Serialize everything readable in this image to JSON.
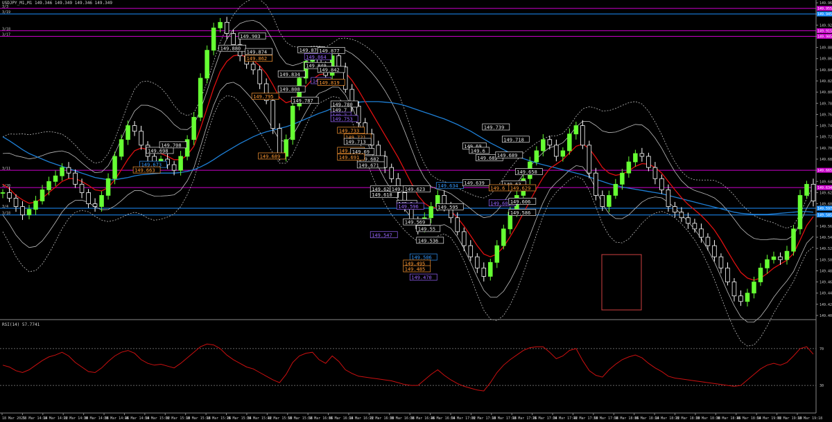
{
  "header": {
    "title": "USDJPY_M1,M1  149.346 149.349 149.346 149.349"
  },
  "rsi_panel": {
    "title": "RSI(14) 57.7741"
  },
  "colors": {
    "background": "#000000",
    "candle_up": "#66ff33",
    "candle_down": "#ffffff",
    "ma_red": "#e01010",
    "ma_blue": "#1e7fd6",
    "band": "#bfbfbf",
    "level_magenta": "#cc00cc",
    "level_blue": "#1e90ff",
    "rsi_line": "#cc1010",
    "label_white": "#e8e8e8",
    "label_orange": "#ff9933",
    "label_purple": "#9966ff",
    "label_blue": "#3399ff"
  },
  "chart_data": [
    {
      "type": "line",
      "name": "price",
      "y_ticks": [
        "149.965",
        "149.945",
        "149.925",
        "149.905",
        "149.885",
        "149.865",
        "149.845",
        "149.825",
        "149.805",
        "149.785",
        "149.765",
        "149.745",
        "149.725",
        "149.705",
        "149.685",
        "149.665",
        "149.645",
        "149.625",
        "149.605",
        "149.585",
        "149.565",
        "149.545",
        "149.525",
        "149.505",
        "149.485",
        "149.465",
        "149.445",
        "149.425",
        "149.405"
      ],
      "ylim": [
        149.4,
        149.97
      ],
      "x_ticks": [
        "18 Mar 2025",
        "18 Mar 14:14",
        "18 Mar 14:22",
        "18 Mar 14:30",
        "18 Mar 14:38",
        "18 Mar 14:46",
        "18 Mar 14:54",
        "18 Mar 15:02",
        "18 Mar 15:10",
        "18 Mar 15:18",
        "18 Mar 15:26",
        "18 Mar 15:34",
        "18 Mar 15:42",
        "18 Mar 15:50",
        "18 Mar 15:58",
        "18 Mar 16:06",
        "18 Mar 16:14",
        "18 Mar 16:22",
        "18 Mar 16:30",
        "18 Mar 16:38",
        "18 Mar 16:46",
        "18 Mar 16:54",
        "18 Mar 17:02",
        "18 Mar 17:10",
        "18 Mar 17:18",
        "18 Mar 17:26",
        "18 Mar 17:34",
        "18 Mar 17:42",
        "18 Mar 17:50",
        "18 Mar 17:58",
        "18 Mar 18:06",
        "18 Mar 18:14",
        "18 Mar 18:22",
        "18 Mar 18:30",
        "18 Mar 18:38",
        "18 Mar 18:46",
        "18 Mar 18:54",
        "18 Mar 19:02",
        "18 Mar 19:10",
        "18 Mar 19:18"
      ],
      "close": [
        149.625,
        149.615,
        149.6,
        149.585,
        149.595,
        149.61,
        149.63,
        149.645,
        149.655,
        149.67,
        149.66,
        149.64,
        149.625,
        149.605,
        149.6,
        149.62,
        149.65,
        149.69,
        149.72,
        149.745,
        149.735,
        149.71,
        149.69,
        149.68,
        149.685,
        149.675,
        149.665,
        149.69,
        149.72,
        149.76,
        149.83,
        149.88,
        149.92,
        149.93,
        149.91,
        149.89,
        149.87,
        149.855,
        149.845,
        149.82,
        149.79,
        149.74,
        149.69,
        149.72,
        149.78,
        149.83,
        149.86,
        149.87,
        149.85,
        149.835,
        149.87,
        149.85,
        149.81,
        149.78,
        149.75,
        149.73,
        149.71,
        149.69,
        149.67,
        149.65,
        149.625,
        149.6,
        149.575,
        149.56,
        149.58,
        149.6,
        149.62,
        149.6,
        149.58,
        149.555,
        149.53,
        149.51,
        149.49,
        149.475,
        149.5,
        149.53,
        149.56,
        149.59,
        149.62,
        149.65,
        149.68,
        149.7,
        149.72,
        149.71,
        149.69,
        149.7,
        149.73,
        149.745,
        149.71,
        149.66,
        149.62,
        149.6,
        149.62,
        149.64,
        149.66,
        149.68,
        149.695,
        149.69,
        149.67,
        149.65,
        149.63,
        149.6,
        149.59,
        149.58,
        149.57,
        149.56,
        149.545,
        149.53,
        149.51,
        149.49,
        149.465,
        149.44,
        149.43,
        149.445,
        149.465,
        149.49,
        149.505,
        149.51,
        149.505,
        149.52,
        149.56,
        149.62,
        149.64,
        149.61
      ],
      "ma_fast": [
        149.64,
        149.632,
        149.62,
        149.612,
        149.606,
        149.608,
        149.615,
        149.625,
        149.635,
        149.645,
        149.65,
        149.65,
        149.645,
        149.638,
        149.63,
        149.628,
        149.634,
        149.648,
        149.666,
        149.685,
        149.7,
        149.705,
        149.702,
        149.698,
        149.695,
        149.69,
        149.684,
        149.684,
        149.692,
        149.708,
        149.74,
        149.776,
        149.812,
        149.842,
        149.86,
        149.87,
        149.872,
        149.868,
        149.862,
        149.852,
        149.838,
        149.818,
        149.795,
        149.786,
        149.79,
        149.802,
        149.815,
        149.828,
        149.836,
        149.838,
        149.845,
        149.848,
        149.84,
        149.826,
        149.808,
        149.788,
        149.768,
        149.748,
        149.728,
        149.708,
        149.688,
        149.665,
        149.642,
        149.62,
        149.606,
        149.598,
        149.598,
        149.598,
        149.592,
        149.58,
        149.565,
        149.548,
        149.53,
        149.515,
        149.51,
        149.515,
        149.528,
        149.546,
        149.566,
        149.588,
        149.61,
        149.632,
        149.652,
        149.668,
        149.676,
        149.684,
        149.696,
        149.708,
        149.712,
        149.704,
        149.688,
        149.67,
        149.66,
        149.656,
        149.658,
        149.664,
        149.672,
        149.677,
        149.676,
        149.67,
        149.66,
        149.645,
        149.63,
        149.616,
        149.604,
        149.594,
        149.584,
        149.572,
        149.558,
        149.54,
        149.52,
        149.5,
        149.482,
        149.472,
        149.468,
        149.472,
        149.48,
        149.49,
        149.497,
        149.504,
        149.516,
        149.54,
        149.566,
        149.582
      ],
      "ma_slow": [
        149.725,
        149.718,
        149.71,
        149.702,
        149.695,
        149.69,
        149.685,
        149.68,
        149.676,
        149.672,
        149.668,
        149.664,
        149.66,
        149.656,
        149.652,
        149.65,
        149.648,
        149.648,
        149.65,
        149.652,
        149.655,
        149.657,
        149.658,
        149.659,
        149.66,
        149.66,
        149.66,
        149.661,
        149.663,
        149.666,
        149.671,
        149.677,
        149.684,
        149.692,
        149.699,
        149.706,
        149.713,
        149.719,
        149.725,
        149.73,
        149.734,
        149.737,
        149.74,
        149.743,
        149.747,
        149.752,
        149.757,
        149.762,
        149.767,
        149.771,
        149.776,
        149.78,
        149.783,
        149.785,
        149.787,
        149.788,
        149.788,
        149.788,
        149.787,
        149.786,
        149.784,
        149.781,
        149.777,
        149.773,
        149.769,
        149.765,
        149.761,
        149.757,
        149.752,
        149.747,
        149.741,
        149.735,
        149.728,
        149.721,
        149.714,
        149.708,
        149.702,
        149.696,
        149.691,
        149.686,
        149.682,
        149.678,
        149.675,
        149.672,
        149.669,
        149.666,
        149.663,
        149.66,
        149.657,
        149.653,
        149.649,
        149.645,
        149.641,
        149.638,
        149.635,
        149.633,
        149.631,
        149.629,
        149.627,
        149.625,
        149.623,
        149.62,
        149.617,
        149.614,
        149.611,
        149.608,
        149.605,
        149.602,
        149.599,
        149.596,
        149.593,
        149.59,
        149.588,
        149.587,
        149.586,
        149.586,
        149.586,
        149.587,
        149.588,
        149.589,
        149.59,
        149.591,
        149.591,
        149.59
      ],
      "horizontal_levels": [
        {
          "price": 149.955,
          "color": "magenta",
          "label": "3/3"
        },
        {
          "price": 149.945,
          "color": "blue",
          "label": "3/19"
        },
        {
          "price": 149.915,
          "color": "magenta",
          "label": "3/18"
        },
        {
          "price": 149.905,
          "color": "magenta",
          "label": "3/17"
        },
        {
          "price": 149.665,
          "color": "magenta",
          "label": "3/11"
        },
        {
          "price": 149.634,
          "color": "magenta",
          "label": "3/20"
        },
        {
          "price": 149.597,
          "color": "blue",
          "label": "3/4"
        },
        {
          "price": 149.585,
          "color": "blue",
          "label": "3/18"
        }
      ],
      "price_labels": [
        {
          "text": "149.903",
          "price": 149.905,
          "i": 36,
          "color": "white"
        },
        {
          "text": "149.880",
          "price": 149.883,
          "i": 33,
          "color": "white"
        },
        {
          "text": "149.874",
          "price": 149.877,
          "i": 37,
          "color": "white"
        },
        {
          "text": "149.862",
          "price": 149.865,
          "i": 37,
          "color": "orange"
        },
        {
          "text": "149.795",
          "price": 149.797,
          "i": 38,
          "color": "orange"
        },
        {
          "text": "149.689",
          "price": 149.69,
          "i": 39,
          "color": "orange"
        },
        {
          "text": "149.698",
          "price": 149.7,
          "i": 22,
          "color": "white"
        },
        {
          "text": "149.708",
          "price": 149.71,
          "i": 24,
          "color": "white"
        },
        {
          "text": "149.673",
          "price": 149.675,
          "i": 21,
          "color": "blue"
        },
        {
          "text": "149.663",
          "price": 149.665,
          "i": 20,
          "color": "orange"
        },
        {
          "text": "149.878",
          "price": 149.88,
          "i": 45,
          "color": "white"
        },
        {
          "text": "149.877",
          "price": 149.879,
          "i": 48,
          "color": "white"
        },
        {
          "text": "149.864",
          "price": 149.868,
          "i": 46,
          "color": "purple"
        },
        {
          "text": "149.849",
          "price": 149.852,
          "i": 46,
          "color": "white"
        },
        {
          "text": "149.842",
          "price": 149.845,
          "i": 48,
          "color": "white"
        },
        {
          "text": "149.834",
          "price": 149.837,
          "i": 42,
          "color": "white"
        },
        {
          "text": "149.8",
          "price": 149.825,
          "i": 47,
          "color": "purple"
        },
        {
          "text": "149.819",
          "price": 149.822,
          "i": 48,
          "color": "orange"
        },
        {
          "text": "149.808",
          "price": 149.81,
          "i": 42,
          "color": "white"
        },
        {
          "text": "149.787",
          "price": 149.79,
          "i": 44,
          "color": "white"
        },
        {
          "text": "149.780",
          "price": 149.783,
          "i": 50,
          "color": "white"
        },
        {
          "text": "149.7",
          "price": 149.773,
          "i": 50,
          "color": "white"
        },
        {
          "text": "149.7",
          "price": 149.763,
          "i": 50,
          "color": "purple"
        },
        {
          "text": "149.753",
          "price": 149.757,
          "i": 50,
          "color": "purple"
        },
        {
          "text": "149.733",
          "price": 149.736,
          "i": 51,
          "color": "orange"
        },
        {
          "text": "149.721",
          "price": 149.724,
          "i": 52,
          "color": "orange"
        },
        {
          "text": "149.713",
          "price": 149.716,
          "i": 52,
          "color": "white"
        },
        {
          "text": "149.697",
          "price": 149.7,
          "i": 51,
          "color": "orange"
        },
        {
          "text": "149.69",
          "price": 149.698,
          "i": 53,
          "color": "white"
        },
        {
          "text": "149.682",
          "price": 149.685,
          "i": 54,
          "color": "white"
        },
        {
          "text": "149.691",
          "price": 149.688,
          "i": 51,
          "color": "orange"
        },
        {
          "text": "149.671",
          "price": 149.674,
          "i": 54,
          "color": "white"
        },
        {
          "text": "149.628",
          "price": 149.631,
          "i": 56,
          "color": "white"
        },
        {
          "text": "149.618",
          "price": 149.621,
          "i": 56,
          "color": "white"
        },
        {
          "text": "149.62",
          "price": 149.631,
          "i": 59,
          "color": "white"
        },
        {
          "text": "149.623",
          "price": 149.631,
          "i": 61,
          "color": "white"
        },
        {
          "text": "149.6",
          "price": 149.605,
          "i": 60,
          "color": "white"
        },
        {
          "text": "149.596",
          "price": 149.6,
          "i": 60,
          "color": "purple"
        },
        {
          "text": "149.569",
          "price": 149.572,
          "i": 61,
          "color": "white"
        },
        {
          "text": "149.547",
          "price": 149.549,
          "i": 56,
          "color": "purple"
        },
        {
          "text": "149.55",
          "price": 149.56,
          "i": 63,
          "color": "white"
        },
        {
          "text": "149.536",
          "price": 149.539,
          "i": 63,
          "color": "white"
        },
        {
          "text": "149.506",
          "price": 149.509,
          "i": 62,
          "color": "blue"
        },
        {
          "text": "149.495",
          "price": 149.498,
          "i": 61,
          "color": "orange"
        },
        {
          "text": "149.485",
          "price": 149.488,
          "i": 61,
          "color": "orange"
        },
        {
          "text": "149.470",
          "price": 149.473,
          "i": 62,
          "color": "purple"
        },
        {
          "text": "149.595",
          "price": 149.599,
          "i": 66,
          "color": "white"
        },
        {
          "text": "149.634",
          "price": 149.637,
          "i": 66,
          "color": "blue"
        },
        {
          "text": "149.639",
          "price": 149.642,
          "i": 70,
          "color": "white"
        },
        {
          "text": "149.69",
          "price": 149.708,
          "i": 70,
          "color": "white"
        },
        {
          "text": "149.6",
          "price": 149.7,
          "i": 71,
          "color": "white"
        },
        {
          "text": "149.682",
          "price": 149.687,
          "i": 72,
          "color": "white"
        },
        {
          "text": "149.739",
          "price": 149.742,
          "i": 73,
          "color": "white"
        },
        {
          "text": "149.718",
          "price": 149.72,
          "i": 76,
          "color": "white"
        },
        {
          "text": "149.689",
          "price": 149.692,
          "i": 75,
          "color": "white"
        },
        {
          "text": "149.658",
          "price": 149.662,
          "i": 78,
          "color": "white"
        },
        {
          "text": "149.63",
          "price": 149.64,
          "i": 76,
          "color": "white"
        },
        {
          "text": "149.6",
          "price": 149.633,
          "i": 74,
          "color": "orange"
        },
        {
          "text": "149.629",
          "price": 149.633,
          "i": 77,
          "color": "orange"
        },
        {
          "text": "149.603",
          "price": 149.606,
          "i": 74,
          "color": "purple"
        },
        {
          "text": "149.606",
          "price": 149.609,
          "i": 77,
          "color": "white"
        },
        {
          "text": "149.586",
          "price": 149.589,
          "i": 77,
          "color": "white"
        }
      ],
      "right_level_labels": [
        {
          "text": "149.955",
          "price": 149.955,
          "color": "magenta"
        },
        {
          "text": "149.945",
          "price": 149.945,
          "color": "blue"
        },
        {
          "text": "149.915",
          "price": 149.915,
          "color": "magenta"
        },
        {
          "text": "149.905",
          "price": 149.905,
          "color": "magenta"
        },
        {
          "text": "149.665",
          "price": 149.665,
          "color": "magenta"
        },
        {
          "text": "149.634",
          "price": 149.634,
          "color": "magenta"
        },
        {
          "text": "149.597",
          "price": 149.597,
          "color": "blue"
        },
        {
          "text": "149.585",
          "price": 149.585,
          "color": "blue"
        }
      ]
    },
    {
      "type": "line",
      "name": "RSI(14)",
      "ylim": [
        0,
        100
      ],
      "levels": [
        70,
        30
      ],
      "y_ticks": [
        "70",
        "30"
      ],
      "values": [
        52,
        50,
        46,
        44,
        47,
        52,
        57,
        61,
        63,
        66,
        62,
        55,
        50,
        45,
        44,
        49,
        56,
        62,
        66,
        68,
        65,
        58,
        54,
        52,
        53,
        51,
        49,
        54,
        60,
        66,
        72,
        75,
        74,
        70,
        63,
        58,
        54,
        50,
        48,
        44,
        40,
        36,
        33,
        42,
        55,
        62,
        65,
        66,
        58,
        54,
        62,
        56,
        47,
        43,
        40,
        39,
        38,
        37,
        36,
        35,
        33,
        31,
        30,
        30,
        36,
        42,
        47,
        41,
        36,
        32,
        29,
        27,
        25,
        24,
        33,
        44,
        52,
        58,
        63,
        68,
        71,
        72,
        72,
        66,
        59,
        62,
        68,
        70,
        57,
        46,
        41,
        39,
        47,
        53,
        58,
        61,
        63,
        60,
        54,
        49,
        45,
        40,
        38,
        37,
        36,
        35,
        34,
        33,
        32,
        31,
        30,
        29,
        30,
        36,
        42,
        48,
        52,
        54,
        52,
        55,
        62,
        70,
        72,
        64
      ]
    }
  ]
}
